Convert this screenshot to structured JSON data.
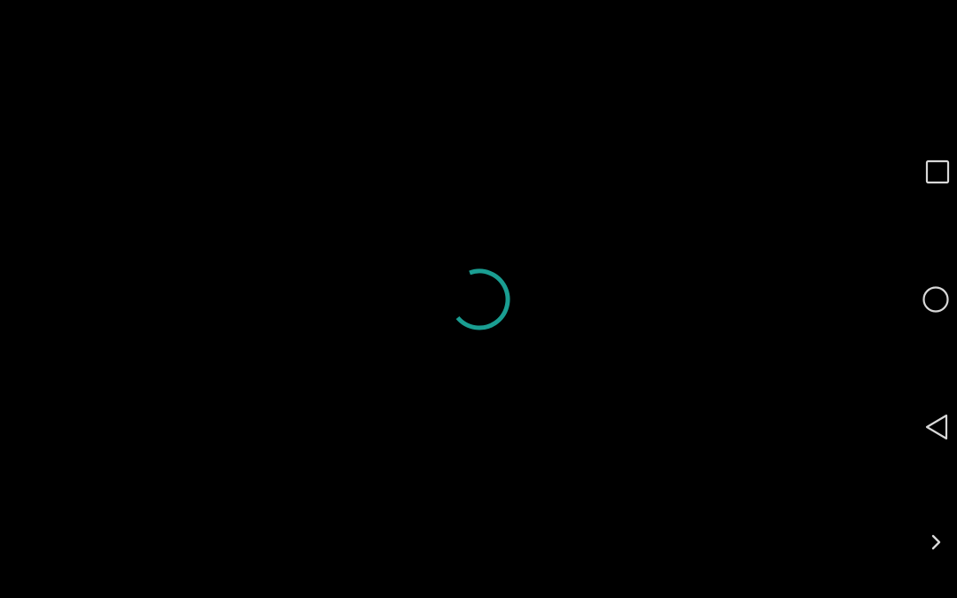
{
  "screen": {
    "background": "#000000"
  },
  "loading": {
    "spinner_color": "#1a9e92",
    "icon": "loading-spinner-icon"
  },
  "nav_bar": {
    "icon_color": "#d8d8d8",
    "buttons": [
      {
        "icon": "recents-square-icon"
      },
      {
        "icon": "home-circle-icon"
      },
      {
        "icon": "back-triangle-icon"
      },
      {
        "icon": "chevron-right-icon"
      }
    ]
  }
}
